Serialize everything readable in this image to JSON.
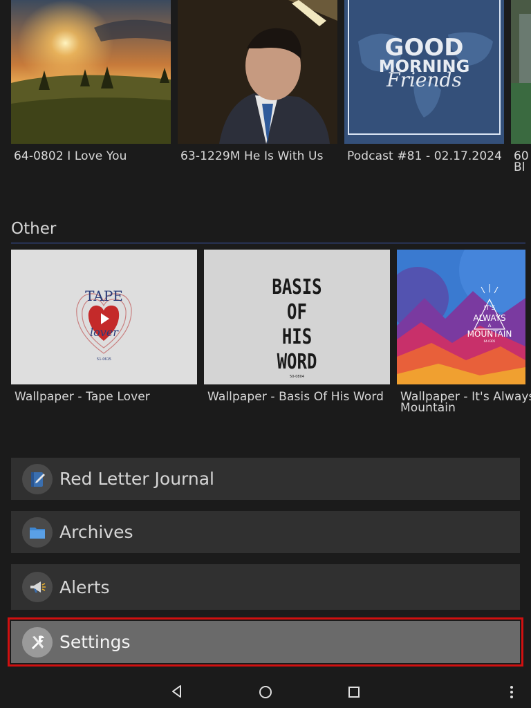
{
  "top_row": {
    "items": [
      {
        "caption": "64-0802 I Love You"
      },
      {
        "caption": "63-1229M He Is With Us"
      },
      {
        "caption": "Podcast #81 - 02.17.2024",
        "art_line1": "GOOD",
        "art_line2": "MORNING",
        "art_line3": "Friends"
      },
      {
        "caption": "60",
        "caption2": "Bl"
      }
    ]
  },
  "other": {
    "title": "Other",
    "items": [
      {
        "caption": "Wallpaper - Tape Lover",
        "art_line1": "TAPE",
        "art_line2": "lover",
        "art_code": "51-0615"
      },
      {
        "caption": "Wallpaper - Basis Of His Word",
        "art_line1": "BASIS",
        "art_line2": "OF",
        "art_line3": "HIS",
        "art_line4": "WORD",
        "art_code": "50-0804"
      },
      {
        "caption": "Wallpaper - It's Always",
        "caption2": "Mountain",
        "art_line1": "IT'S",
        "art_line2": "ALWAYS",
        "art_line3": "A",
        "art_line4": "MOUNTAIN",
        "art_code": "64-0305"
      }
    ]
  },
  "menu": [
    {
      "label": "Red Letter Journal",
      "icon": "journal-icon"
    },
    {
      "label": "Archives",
      "icon": "folder-icon"
    },
    {
      "label": "Alerts",
      "icon": "megaphone-icon"
    },
    {
      "label": "Settings",
      "icon": "tools-icon"
    }
  ],
  "colors": {
    "background": "#1b1b1b",
    "row": "#303030",
    "selected_row": "#6a6a6a",
    "highlight": "#d01010",
    "accent_rule": "#3d59b3"
  }
}
